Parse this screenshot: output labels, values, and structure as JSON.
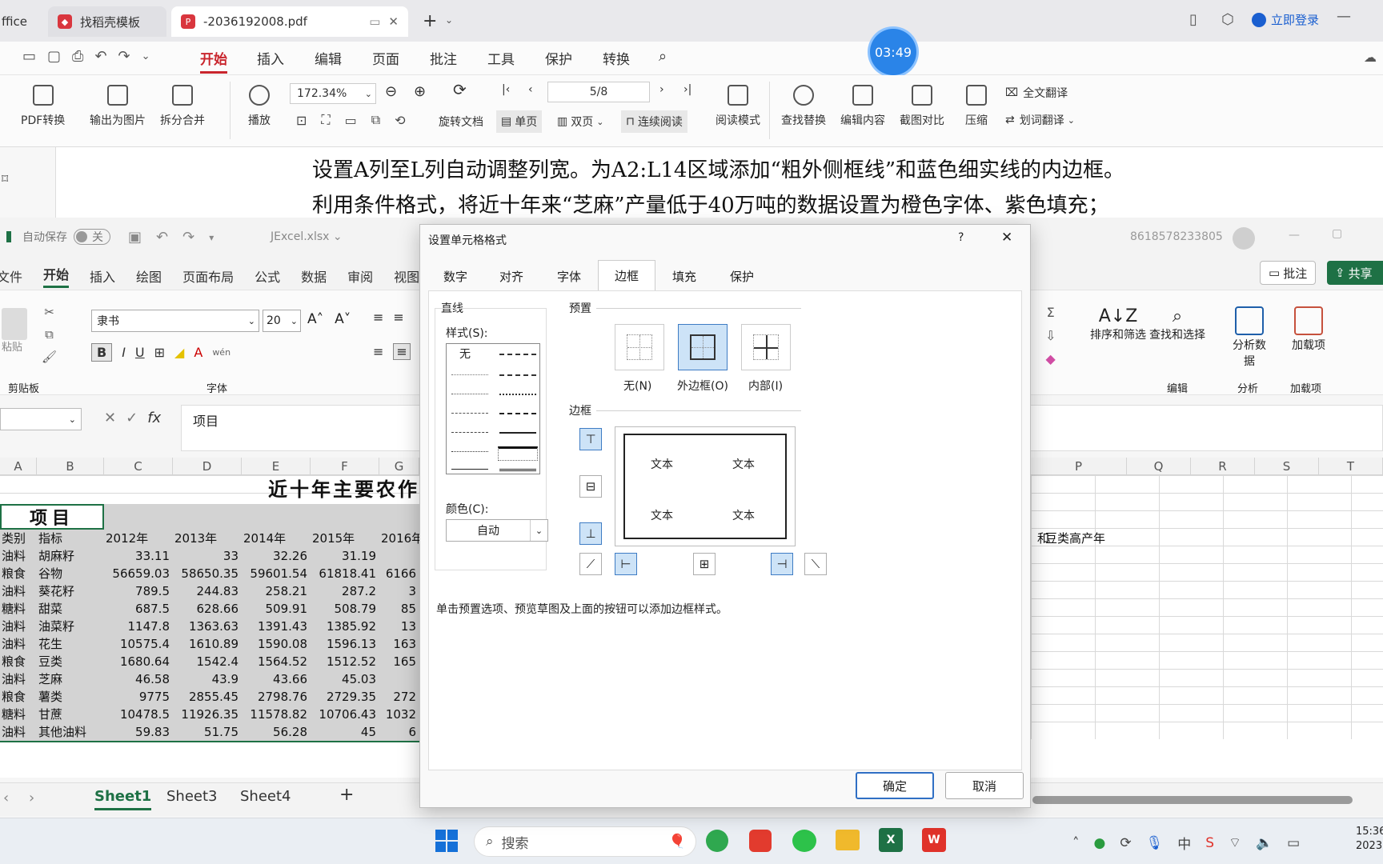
{
  "pdf": {
    "tabs": [
      {
        "label": "ffice"
      },
      {
        "label": "找稻壳模板"
      },
      {
        "label": "-2036192008.pdf"
      }
    ],
    "login": "立即登录",
    "timer": "03:49",
    "menu": [
      "开始",
      "插入",
      "编辑",
      "页面",
      "批注",
      "工具",
      "保护",
      "转换"
    ],
    "ribbon": {
      "pdf_convert": "PDF转换",
      "export_image": "输出为图片",
      "split_merge": "拆分合并",
      "play": "播放",
      "zoom": "172.34%",
      "page": "5/8",
      "rotate": "旋转文档",
      "single": "单页",
      "double": "双页",
      "continuous": "连续阅读",
      "read_mode": "阅读模式",
      "find_replace": "查找替换",
      "edit_content": "编辑内容",
      "screenshot_compare": "截图对比",
      "compress": "压缩",
      "full_translate": "全文翻译",
      "word_translate": "划词翻译"
    },
    "content": [
      "设置A列至L列自动调整列宽。为A2:L14区域添加“粗外侧框线”和蓝色细实线的内边框。",
      "利用条件格式，将近十年来“芝麻”产量低于40万吨的数据设置为橙色字体、紫色填充；"
    ]
  },
  "excel": {
    "autosave": "自动保存",
    "autosave_state": "关",
    "filename": "JExcel.xlsx",
    "user": "8618578233805",
    "menu": [
      "文件",
      "开始",
      "插入",
      "绘图",
      "页面布局",
      "公式",
      "数据",
      "审阅",
      "视图"
    ],
    "comment_btn": "批注",
    "share_btn": "共享",
    "font_name": "隶书",
    "font_size": "20",
    "paste": "粘贴",
    "clipboard": "剪贴板",
    "font_group": "字体",
    "sort_filter": "排序和筛选",
    "find_select": "查找和选择",
    "analyze": "分析数据",
    "addins": "加载项",
    "edit_group": "编辑",
    "analyze_group": "分析",
    "addins_group": "加载项",
    "formula_value": "项目",
    "columns": [
      "A",
      "B",
      "C",
      "D",
      "E",
      "F",
      "G",
      "P",
      "Q",
      "R",
      "S",
      "T"
    ],
    "title_cell": "近十年主要农作",
    "header_cell": "项目",
    "row_headers": [
      "类别",
      "指标",
      "2012年",
      "2013年",
      "2014年",
      "2015年",
      "2016年"
    ],
    "rows": [
      [
        "油料",
        "胡麻籽",
        "33.11",
        "33",
        "32.26",
        "31.19",
        ""
      ],
      [
        "粮食",
        "谷物",
        "56659.03",
        "58650.35",
        "59601.54",
        "61818.41",
        "6166"
      ],
      [
        "油料",
        "葵花籽",
        "789.5",
        "244.83",
        "258.21",
        "287.2",
        "3"
      ],
      [
        "糖料",
        "甜菜",
        "687.5",
        "628.66",
        "509.91",
        "508.79",
        "85"
      ],
      [
        "油料",
        "油菜籽",
        "1147.8",
        "1363.63",
        "1391.43",
        "1385.92",
        "13"
      ],
      [
        "油料",
        "花生",
        "10575.4",
        "1610.89",
        "1590.08",
        "1596.13",
        "163"
      ],
      [
        "粮食",
        "豆类",
        "1680.64",
        "1542.4",
        "1564.52",
        "1512.52",
        "165"
      ],
      [
        "油料",
        "芝麻",
        "46.58",
        "43.9",
        "43.66",
        "45.03",
        ""
      ],
      [
        "粮食",
        "薯类",
        "9775",
        "2855.45",
        "2798.76",
        "2729.35",
        "272"
      ],
      [
        "糖料",
        "甘蔗",
        "10478.5",
        "11926.35",
        "11578.82",
        "10706.43",
        "1032"
      ],
      [
        "油料",
        "其他油料",
        "59.83",
        "51.75",
        "56.28",
        "45",
        "6"
      ]
    ],
    "side_text_1": "和",
    "side_text_2": "豆类高产年",
    "sheets": [
      "Sheet1",
      "Sheet3",
      "Sheet4"
    ]
  },
  "dialog": {
    "title": "设置单元格格式",
    "help": "?",
    "tabs": [
      "数字",
      "对齐",
      "字体",
      "边框",
      "填充",
      "保护"
    ],
    "active_tab": "边框",
    "line_group": "直线",
    "style_label": "样式(S):",
    "none_style": "无",
    "color_label": "颜色(C):",
    "color_value": "自动",
    "preset_group": "预置",
    "presets": [
      "无(N)",
      "外边框(O)",
      "内部(I)"
    ],
    "border_group": "边框",
    "preview_text": [
      "文本",
      "文本",
      "文本",
      "文本"
    ],
    "hint": "单击预置选项、预览草图及上面的按钮可以添加边框样式。",
    "ok": "确定",
    "cancel": "取消"
  },
  "taskbar": {
    "search": "搜索",
    "time": "15:36",
    "date": "2023"
  }
}
